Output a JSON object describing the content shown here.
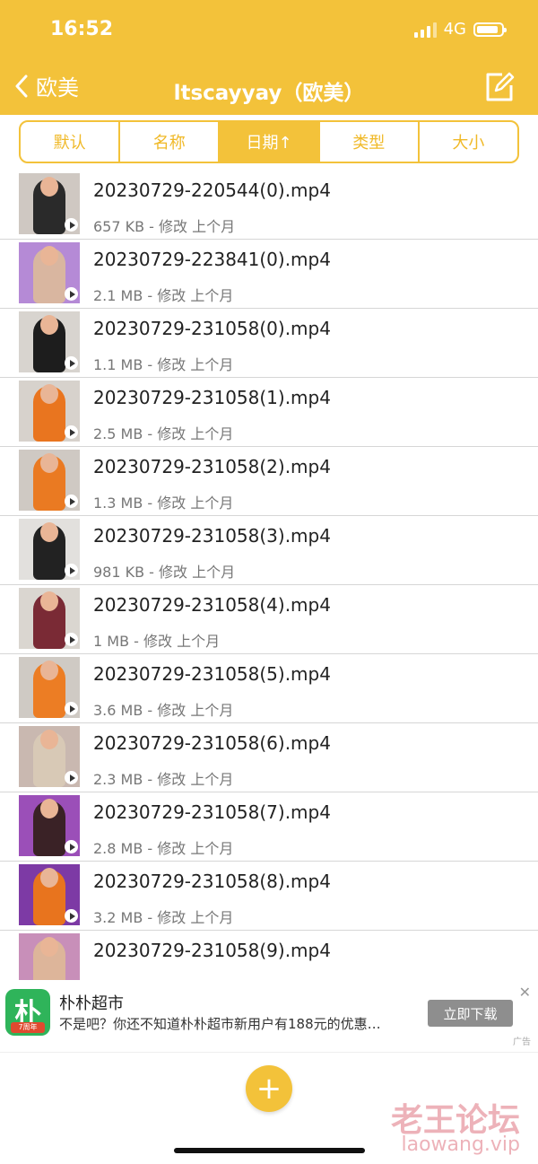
{
  "status_bar": {
    "time": "16:52",
    "network": "4G"
  },
  "header": {
    "back_label": "欧美",
    "title": "ltscayyay（欧美）"
  },
  "sort_tabs": [
    {
      "label": "默认",
      "active": false
    },
    {
      "label": "名称",
      "active": false
    },
    {
      "label": "日期↑",
      "active": true
    },
    {
      "label": "类型",
      "active": false
    },
    {
      "label": "大小",
      "active": false
    }
  ],
  "files": [
    {
      "name": "20230729-220544(0).mp4",
      "meta": "657 KB - 修改 上个月"
    },
    {
      "name": "20230729-223841(0).mp4",
      "meta": "2.1 MB - 修改 上个月"
    },
    {
      "name": "20230729-231058(0).mp4",
      "meta": "1.1 MB - 修改 上个月"
    },
    {
      "name": "20230729-231058(1).mp4",
      "meta": "2.5 MB - 修改 上个月"
    },
    {
      "name": "20230729-231058(2).mp4",
      "meta": "1.3 MB - 修改 上个月"
    },
    {
      "name": "20230729-231058(3).mp4",
      "meta": "981 KB - 修改 上个月"
    },
    {
      "name": "20230729-231058(4).mp4",
      "meta": "1 MB - 修改 上个月"
    },
    {
      "name": "20230729-231058(5).mp4",
      "meta": "3.6 MB - 修改 上个月"
    },
    {
      "name": "20230729-231058(6).mp4",
      "meta": "2.3 MB - 修改 上个月"
    },
    {
      "name": "20230729-231058(7).mp4",
      "meta": "2.8 MB - 修改 上个月"
    },
    {
      "name": "20230729-231058(8).mp4",
      "meta": "3.2 MB - 修改 上个月"
    },
    {
      "name": "20230729-231058(9).mp4",
      "meta": ""
    }
  ],
  "ad": {
    "logo_char": "朴",
    "logo_badge": "7周年",
    "title": "朴朴超市",
    "description": "不是吧？你还不知道朴朴超市新用户有188元的优惠…",
    "button": "立即下载",
    "close": "✕",
    "tag": "广告"
  },
  "fab": {
    "label": "+"
  },
  "watermark": {
    "cn": "老王论坛",
    "en": "laowang.vip"
  },
  "colors": {
    "accent": "#f3c23a",
    "divider": "#d6d6d6"
  }
}
